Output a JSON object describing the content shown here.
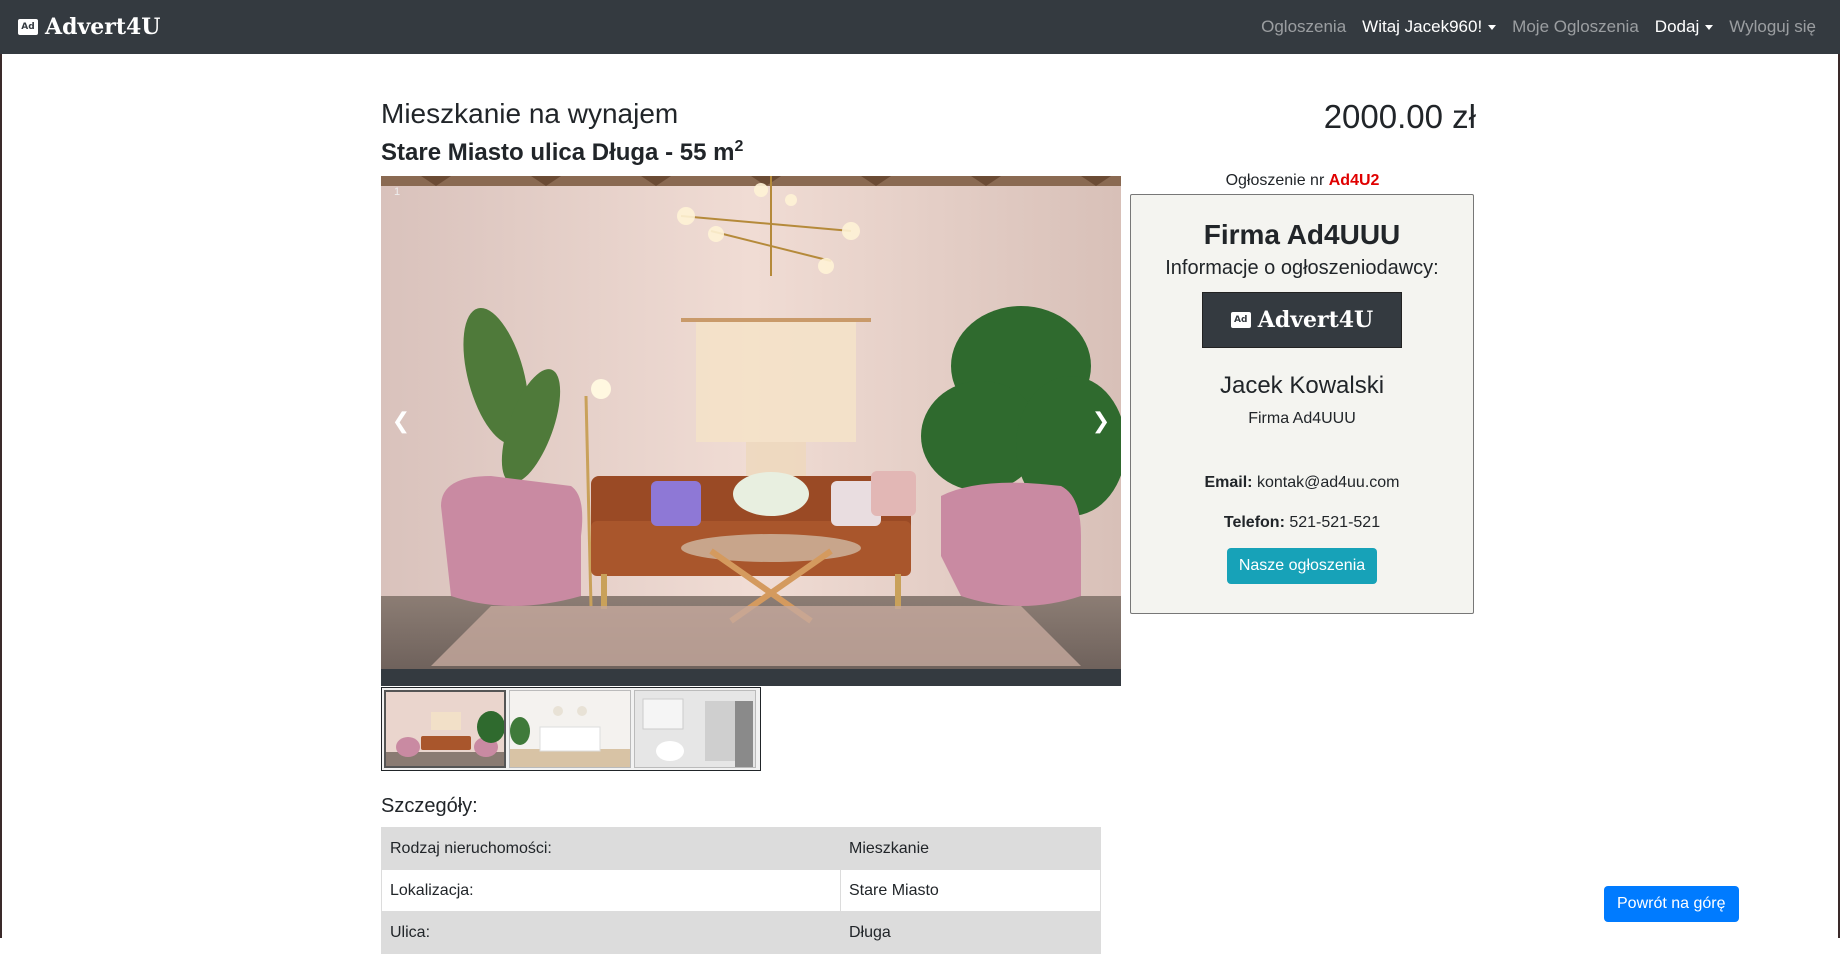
{
  "navbar": {
    "brand_badge": "Ad",
    "brand": "Advert4U",
    "links": {
      "listings": "Ogloszenia",
      "welcome": "Witaj Jacek960!",
      "my_listings": "Moje Ogloszenia",
      "add": "Dodaj",
      "logout": "Wyloguj się"
    }
  },
  "listing": {
    "title": "Mieszkanie na wynajem",
    "subtitle": "Stare Miasto ulica Długa - 55 m",
    "subtitle_sup": "2",
    "price": "2000.00 zł",
    "ad_number_label": "Ogłoszenie nr",
    "ad_number": "Ad4U2"
  },
  "carousel": {
    "slide_number": "1",
    "prev_label": "❮",
    "next_label": "❯",
    "thumbnails": [
      "living-room",
      "kitchen",
      "bathroom"
    ],
    "selected_index": 0
  },
  "advertiser": {
    "company": "Firma Ad4UUU",
    "info_label": "Informacje o ogłoszeniodawcy:",
    "logo_badge": "Ad",
    "logo_text": "Advert4U",
    "name": "Jacek Kowalski",
    "firm": "Firma Ad4UUU",
    "email_label": "Email:",
    "email": "kontak@ad4uu.com",
    "phone_label": "Telefon:",
    "phone": "521-521-521",
    "button": "Nasze ogłoszenia"
  },
  "details": {
    "title": "Szczegóły:",
    "rows": [
      {
        "label": "Rodzaj nieruchomości:",
        "value": "Mieszkanie"
      },
      {
        "label": "Lokalizacja:",
        "value": "Stare Miasto"
      },
      {
        "label": "Ulica:",
        "value": "Długa"
      }
    ]
  },
  "back_to_top": "Powrót na górę",
  "colors": {
    "navbar": "#343a40",
    "info_button": "#17a2b8",
    "primary_button": "#007bff",
    "ad_number": "#e00000",
    "card_bg": "#f4f4f0"
  }
}
